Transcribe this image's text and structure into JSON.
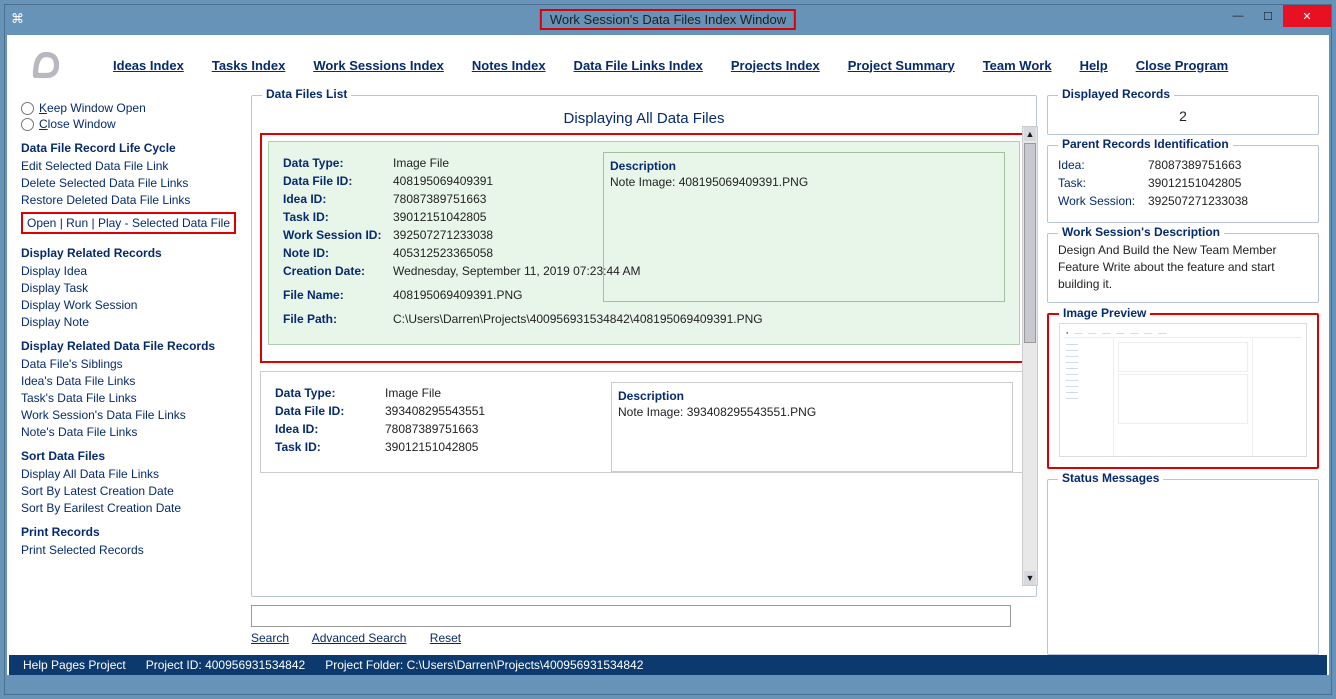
{
  "title": "Work Session's Data Files Index Window",
  "menu": {
    "ideas": "Ideas Index",
    "tasks": "Tasks Index",
    "work_sessions": "Work Sessions Index",
    "notes": "Notes Index",
    "data_file_links": "Data File Links Index",
    "projects": "Projects Index",
    "project_summary": "Project Summary",
    "team_work": "Team Work",
    "help": "Help",
    "close": "Close Program"
  },
  "sidebar": {
    "keep_open": "Keep Window Open",
    "close_window": "Close Window",
    "life_cycle_h": "Data File Record Life Cycle",
    "edit": "Edit Selected Data File Link",
    "delete": "Delete Selected Data File Links",
    "restore": "Restore Deleted Data File Links",
    "open_run": "Open | Run | Play - Selected Data File",
    "related_h": "Display Related Records",
    "disp_idea": "Display Idea",
    "disp_task": "Display Task",
    "disp_ws": "Display Work Session",
    "disp_note": "Display Note",
    "related_df_h": "Display Related Data File Records",
    "siblings": "Data File's Siblings",
    "idea_links": "Idea's Data File Links",
    "task_links": "Task's Data File Links",
    "ws_links": "Work Session's Data File Links",
    "note_links": "Note's Data File Links",
    "sort_h": "Sort Data Files",
    "disp_all": "Display All Data File Links",
    "sort_latest": "Sort By Latest Creation Date",
    "sort_earliest": "Sort By Earilest Creation Date",
    "print_h": "Print Records",
    "print_sel": "Print Selected Records"
  },
  "list": {
    "fieldset": "Data Files List",
    "heading": "Displaying All Data Files",
    "records": [
      {
        "data_type": "Image File",
        "data_file_id": "408195069409391",
        "idea_id": "78087389751663",
        "task_id": "39012151042805",
        "work_session_id": "392507271233038",
        "note_id": "405312523365058",
        "creation_date": "Wednesday, September 11, 2019   07:23:44 AM",
        "file_name": "408195069409391.PNG",
        "file_path": "C:\\Users\\Darren\\Projects\\400956931534842\\408195069409391.PNG",
        "description": "Note Image: 408195069409391.PNG"
      },
      {
        "data_type": "Image File",
        "data_file_id": "393408295543551",
        "idea_id": "78087389751663",
        "task_id": "39012151042805",
        "description": "Note Image: 393408295543551.PNG"
      }
    ]
  },
  "labels": {
    "data_type": "Data Type:",
    "data_file_id": "Data File ID:",
    "idea_id": "Idea ID:",
    "task_id": "Task ID:",
    "work_session_id": "Work Session ID:",
    "note_id": "Note ID:",
    "creation_date": "Creation Date:",
    "file_name": "File Name:",
    "file_path": "File Path:",
    "description": "Description"
  },
  "search": {
    "search": "Search",
    "advanced": "Advanced Search",
    "reset": "Reset"
  },
  "right": {
    "displayed_records_h": "Displayed Records",
    "displayed_count": "2",
    "parent_h": "Parent Records Identification",
    "idea_l": "Idea:",
    "idea_v": "78087389751663",
    "task_l": "Task:",
    "task_v": "39012151042805",
    "ws_l": "Work Session:",
    "ws_v": "392507271233038",
    "ws_desc_h": "Work Session's Description",
    "ws_desc": "Design And Build the New Team Member Feature Write about the feature and start building it.",
    "img_preview_h": "Image Preview",
    "status_h": "Status Messages"
  },
  "status": {
    "help": "Help Pages Project",
    "project_id": "Project ID:  400956931534842",
    "project_folder": "Project Folder:  C:\\Users\\Darren\\Projects\\400956931534842"
  }
}
